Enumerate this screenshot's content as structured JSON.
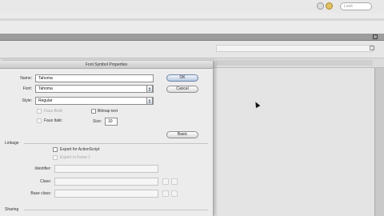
{
  "background": {
    "search_placeholder": "Look"
  },
  "dialog": {
    "title": "Font Symbol Properties",
    "name_label": "Name:",
    "name_value": "Tahoma",
    "font_label": "Font:",
    "font_value": "Tahoma",
    "style_label": "Style:",
    "style_value": "Regular",
    "faux_bold_label": "Faux Bold",
    "faux_italic_label": "Faux Italic",
    "bitmap_text_label": "Bitmap text",
    "size_label": "Size:",
    "size_value": "10",
    "ok_label": "OK",
    "cancel_label": "Cancel",
    "basic_label": "Basic",
    "linkage_label": "Linkage",
    "export_as_label": "Export for ActionScript",
    "export_frame_label": "Export in frame 1",
    "identifier_label": "Identifier:",
    "class_label": "Class:",
    "base_class_label": "Base class:",
    "sharing_label": "Sharing"
  }
}
